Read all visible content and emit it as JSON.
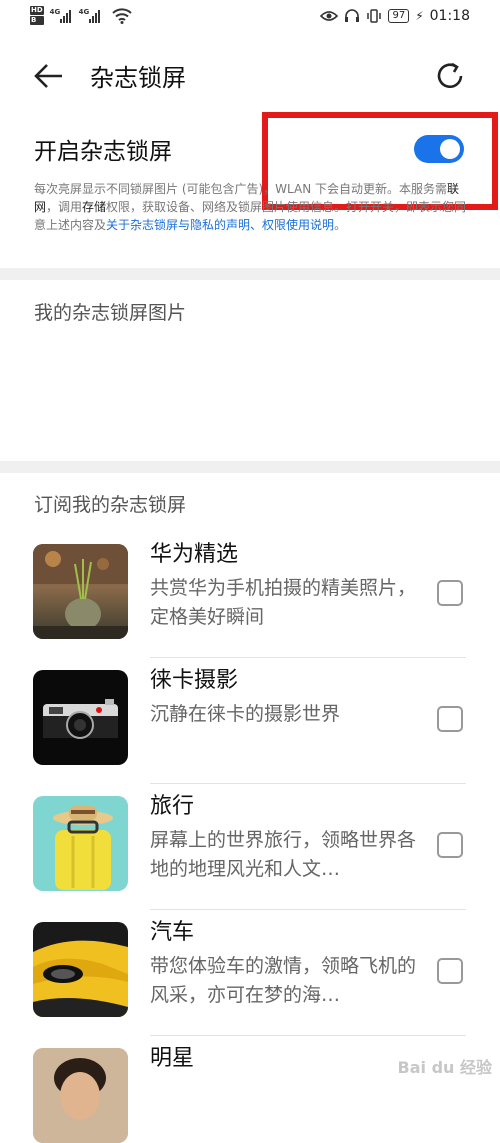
{
  "status_bar": {
    "sim1_labels": [
      "HD",
      "B"
    ],
    "sim2_labels": [
      "HD",
      "B"
    ],
    "network1": "4G",
    "network2": "4G",
    "battery": "97",
    "time": "01:18"
  },
  "header": {
    "title": "杂志锁屏"
  },
  "toggle": {
    "label": "开启杂志锁屏",
    "on": true
  },
  "description": {
    "part1": "每次亮屏显示不同锁屏图片 (可能包含广告)，WLAN 下会自动更新。本服务需",
    "bold1": "联网",
    "part2": "，调用",
    "bold2": "存储",
    "part3": "权限，获取设备、网络及锁屏图片使用信息。打开开关，即表示您同意上述内容及",
    "link1": "关于杂志锁屏与隐私的声明",
    "sep": "、",
    "link2": "权限使用说明",
    "end": "。"
  },
  "my_pictures": {
    "title": "我的杂志锁屏图片"
  },
  "subscribe": {
    "title": "订阅我的杂志锁屏",
    "items": [
      {
        "title": "华为精选",
        "desc": "共赏华为手机拍摄的精美照片，定格美好瞬间",
        "checked": false
      },
      {
        "title": "徕卡摄影",
        "desc": "沉静在徕卡的摄影世界",
        "checked": false
      },
      {
        "title": "旅行",
        "desc": "屏幕上的世界旅行，领略世界各地的地理风光和人文…",
        "checked": false
      },
      {
        "title": "汽车",
        "desc": "带您体验车的激情，领略飞机的风采，亦可在梦的海…",
        "checked": false
      },
      {
        "title": "明星",
        "desc": "",
        "checked": false
      }
    ]
  },
  "watermark": "Bai du 经验"
}
